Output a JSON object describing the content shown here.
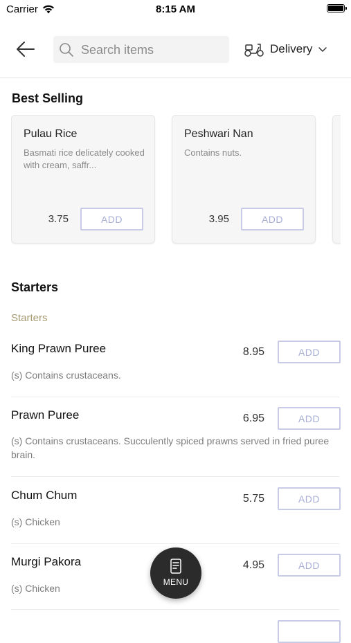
{
  "status_bar": {
    "carrier": "Carrier",
    "time": "8:15 AM"
  },
  "header": {
    "search_placeholder": "Search items",
    "delivery_label": "Delivery"
  },
  "best_selling": {
    "title": "Best Selling",
    "items": [
      {
        "name": "Pulau Rice",
        "description": "Basmati rice delicately cooked with cream, saffr...",
        "price": "3.75",
        "add_label": "ADD"
      },
      {
        "name": "Peshwari Nan",
        "description": "Contains nuts.",
        "price": "3.95",
        "add_label": "ADD"
      }
    ]
  },
  "starters": {
    "title": "Starters",
    "category": "Starters",
    "items": [
      {
        "name": "King Prawn Puree",
        "price": "8.95",
        "description": "(s) Contains crustaceans.",
        "add_label": "ADD"
      },
      {
        "name": "Prawn Puree",
        "price": "6.95",
        "description": "(s) Contains crustaceans. Succulently spiced prawns served in fried puree brain.",
        "add_label": "ADD"
      },
      {
        "name": "Chum Chum",
        "price": "5.75",
        "description": "(s) Chicken",
        "add_label": "ADD"
      },
      {
        "name": "Murgi Pakora",
        "price": "4.95",
        "description": "(s) Chicken",
        "add_label": "ADD"
      }
    ]
  },
  "fab": {
    "label": "MENU"
  }
}
